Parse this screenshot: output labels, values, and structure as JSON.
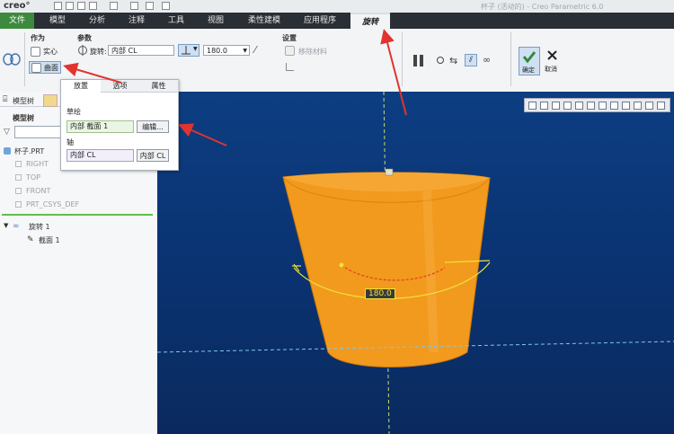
{
  "titlebar": {
    "logo": "creo°",
    "window_title": "杯子 (活动的) - Creo Parametric 6.0"
  },
  "tabs": [
    {
      "label": "文件"
    },
    {
      "label": "模型"
    },
    {
      "label": "分析"
    },
    {
      "label": "注释"
    },
    {
      "label": "工具"
    },
    {
      "label": "视图"
    },
    {
      "label": "柔性建模"
    },
    {
      "label": "应用程序"
    },
    {
      "label": "旋转"
    }
  ],
  "ribbon": {
    "group_as": "作为",
    "solid_label": "实心",
    "surface_label": "曲面",
    "group_params": "参数",
    "rotate_axis_label": "旋转:",
    "axis_value": "内部 CL",
    "angle_value": "180.0",
    "group_settings": "设置",
    "remove_material_label": "移除材料",
    "confirm_label": "确定",
    "cancel_label": "取消"
  },
  "panel": {
    "tabs": [
      "放置",
      "选项",
      "属性"
    ],
    "sketch_label": "草绘",
    "sketch_value": "内部 截面 1",
    "edit_button": "编辑...",
    "axis_label": "轴",
    "axis_value": "内部 CL",
    "axis_button": "内部 CL"
  },
  "left_panel": {
    "tab_model_tree": "模型树",
    "model_tree_header": "模型树",
    "part_name": "杯子.PRT",
    "datum_items": [
      "RIGHT",
      "TOP",
      "FRONT",
      "PRT_CSYS_DEF"
    ],
    "feature": "旋转 1",
    "section": "截面 1"
  },
  "viewport": {
    "dimension_label": "180.0"
  },
  "colors": {
    "accent_green": "#3c8a3e",
    "model_orange": "#f29a1d",
    "viewport_blue": "#0a3372",
    "annotation_red": "#e1342f"
  }
}
